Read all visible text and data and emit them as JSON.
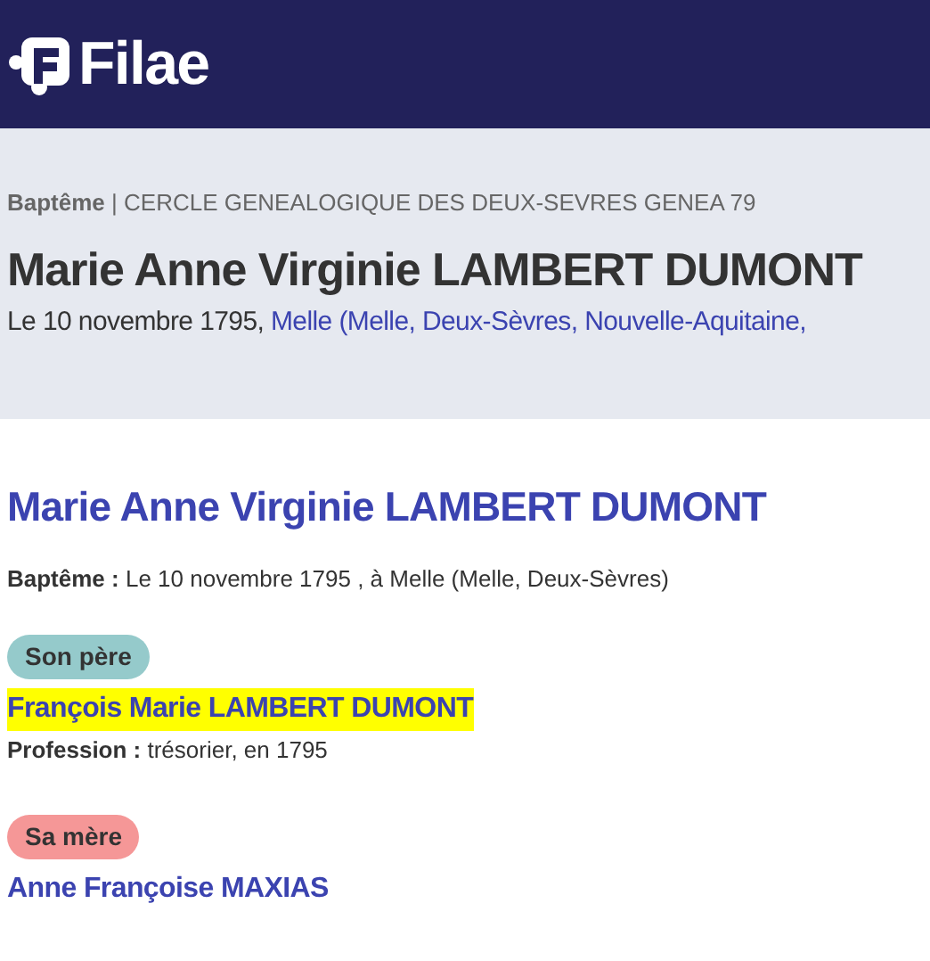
{
  "header": {
    "logo_text": "Filae"
  },
  "record": {
    "breadcrumb": "**Baptême** | CERCLE GENEALOGIQUE DES DEUX-SEVRES GENEA 79",
    "title": "Marie Anne Virginie LAMBERT DUMONT",
    "date": "Le 10 novembre 1795, ",
    "place_link": "Melle (Melle, Deux-Sèvres, Nouvelle-Aquitaine,"
  },
  "person": {
    "name": "Marie Anne Virginie LAMBERT DUMONT",
    "event": "**Baptême :** Le 10 novembre 1795 , à Melle (Melle, Deux-Sèvres)"
  },
  "parents": [
    {
      "badge": "Son père",
      "color": "#95cacb",
      "name": "François Marie LAMBERT DUMONT",
      "highlighted": true,
      "detail": "**Profession :** trésorier, en 1795"
    },
    {
      "badge": "Sa mère",
      "color": "#f59797",
      "name": "Anne Françoise MAXIAS",
      "highlighted": false
    }
  ]
}
